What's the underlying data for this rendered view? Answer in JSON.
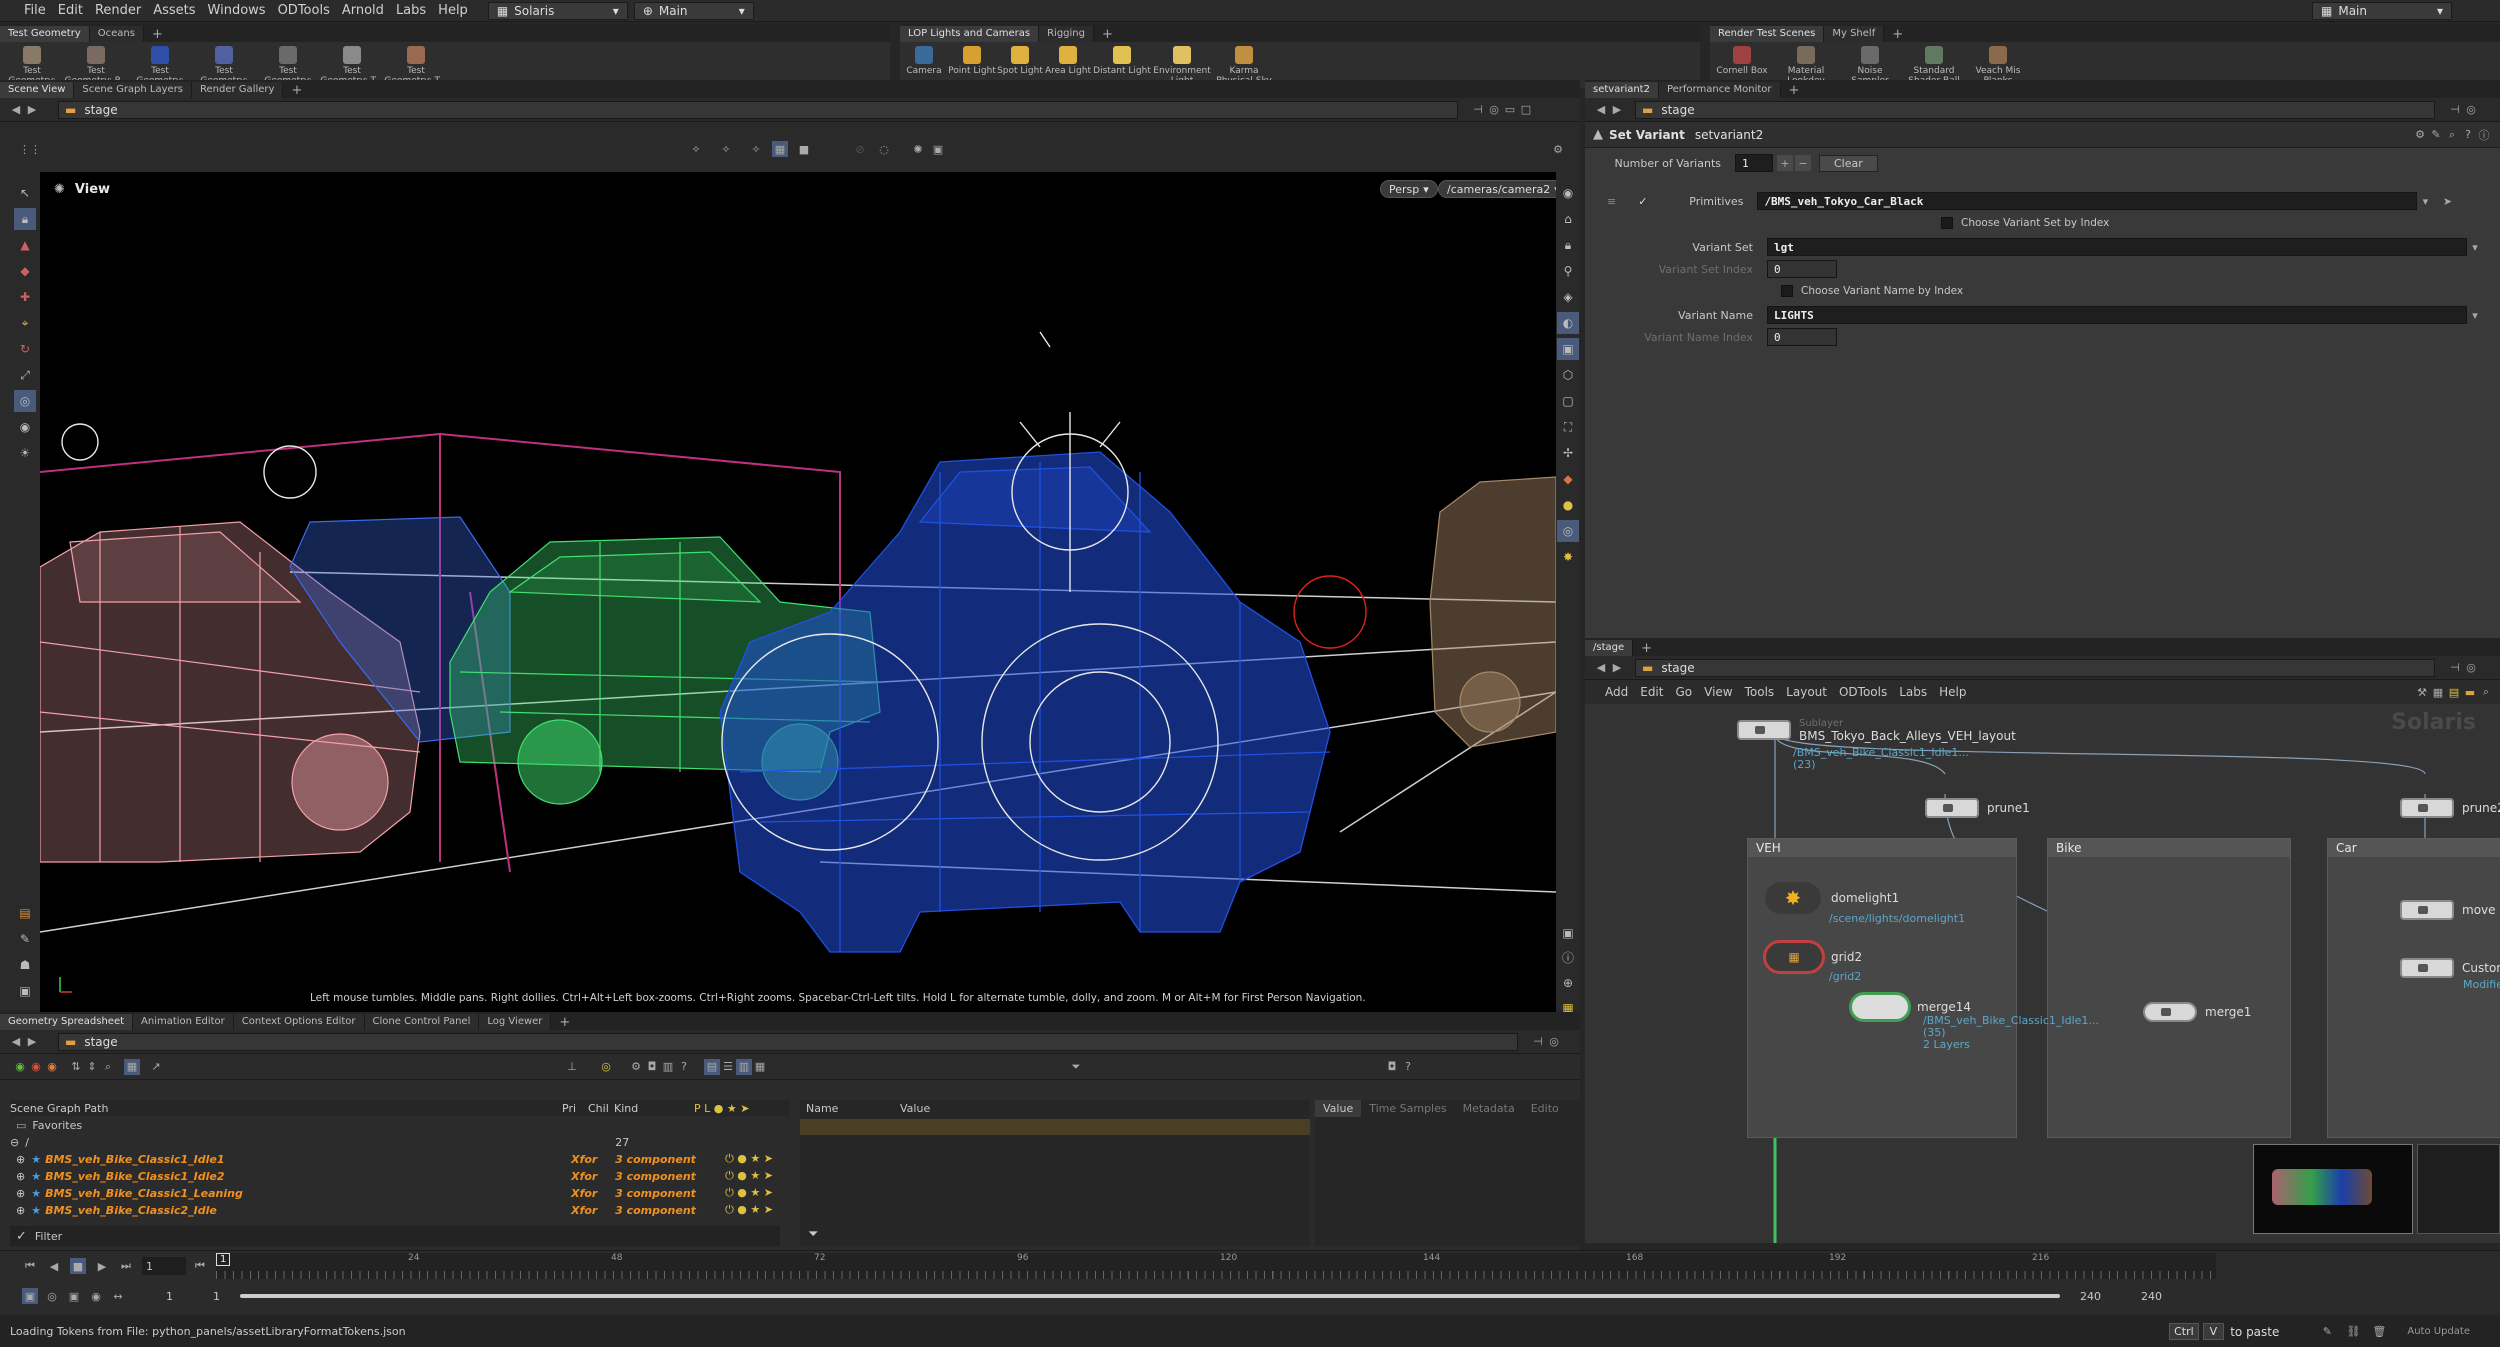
{
  "menubar": {
    "items": [
      "File",
      "Edit",
      "Render",
      "Assets",
      "Windows",
      "ODTools",
      "Arnold",
      "Labs",
      "Help"
    ],
    "desktop": "Solaris",
    "context": "Main",
    "right_desktop": "Main"
  },
  "shelf_left": {
    "tabs": [
      "Test Geometry",
      "Oceans"
    ],
    "tools": [
      "Test Geometry: C...",
      "Test Geometry: P...",
      "Test Geometry: R...",
      "Test Geometry: S...",
      "Test Geometry: S...",
      "Test Geometry: T...",
      "Test Geometry: T..."
    ]
  },
  "shelf_mid": {
    "tabs": [
      "LOP Lights and Cameras",
      "Rigging"
    ],
    "tools": [
      "Camera",
      "Point Light",
      "Spot Light",
      "Area Light",
      "Distant Light",
      "Environment Light",
      "Karma Physical Sky"
    ]
  },
  "shelf_right": {
    "tabs": [
      "Render Test Scenes",
      "My Shelf"
    ],
    "tools": [
      "Cornell Box",
      "Material Lookdev",
      "Noise Sampler",
      "Standard Shader Ball",
      "Veach Mis Planks"
    ]
  },
  "viewer": {
    "tabs": [
      "Scene View",
      "Scene Graph Layers",
      "Render Gallery"
    ],
    "path": "stage",
    "title": "View",
    "persp": "Persp",
    "camera": "/cameras/camera2",
    "hint": "Left mouse tumbles. Middle pans. Right dollies. Ctrl+Alt+Left box-zooms. Ctrl+Right zooms. Spacebar-Ctrl-Left tilts. Hold L for alternate tumble, dolly, and zoom. M or Alt+M for First Person Navigation."
  },
  "params": {
    "tabs": [
      "setvariant2",
      "Performance Monitor"
    ],
    "path": "stage",
    "node_type": "Set Variant",
    "node_name": "setvariant2",
    "num_variants_label": "Number of Variants",
    "num_variants": "1",
    "clear_label": "Clear",
    "primitives_label": "Primitives",
    "primitives": "/BMS_veh_Tokyo_Car_Black",
    "choose_set_index": "Choose Variant Set by Index",
    "variant_set_label": "Variant Set",
    "variant_set": "lgt",
    "variant_set_index_label": "Variant Set Index",
    "variant_set_index": "0",
    "choose_name_index": "Choose Variant Name by Index",
    "variant_name_label": "Variant Name",
    "variant_name": "LIGHTS",
    "variant_name_index_label": "Variant Name Index",
    "variant_name_index": "0"
  },
  "network": {
    "tab": "/stage",
    "path": "stage",
    "menu": [
      "Add",
      "Edit",
      "Go",
      "View",
      "Tools",
      "Layout",
      "ODTools",
      "Labs",
      "Help"
    ],
    "watermark": "Solaris",
    "sublayer_type": "Sublayer",
    "sublayer_name": "BMS_Tokyo_Back_Alleys_VEH_layout",
    "sublayer_path": "/BMS_veh_Bike_Classic1_Idle1...",
    "sublayer_count": "(23)",
    "prune1": "prune1",
    "prune2": "prune2",
    "boxes": [
      "VEH",
      "Bike",
      "Car"
    ],
    "domelight": "domelight1",
    "domelight_path": "/scene/lights/domelight1",
    "grid": "grid2",
    "grid_path": "/grid2",
    "merge14": "merge14",
    "merge14_path": "/BMS_veh_Bike_Classic1_Idle1...",
    "merge14_count": "(35)",
    "merge14_layers": "2 Layers",
    "merge_other": "merge1",
    "move": "move",
    "custom": "Custom_",
    "custom_sub": "Modified:"
  },
  "scene_graph": {
    "tabs": [
      "Geometry Spreadsheet",
      "Animation Editor",
      "Context Options Editor",
      "Clone Control Panel",
      "Log Viewer"
    ],
    "path": "stage",
    "columns": [
      "Scene Graph Path",
      "Pri",
      "Chil",
      "Kind"
    ],
    "favorites": "Favorites",
    "root": "/",
    "root_count": "27",
    "rows": [
      {
        "name": "BMS_veh_Bike_Classic1_Idle1",
        "type": "Xfor",
        "kind": "3 component"
      },
      {
        "name": "BMS_veh_Bike_Classic1_Idle2",
        "type": "Xfor",
        "kind": "3 component"
      },
      {
        "name": "BMS_veh_Bike_Classic1_Leaning",
        "type": "Xfor",
        "kind": "3 component"
      },
      {
        "name": "BMS_veh_Bike_Classic2_Idle",
        "type": "Xfor",
        "kind": "3 component"
      }
    ],
    "filter": "Filter",
    "attr_cols": [
      "Name",
      "Value"
    ],
    "value_tabs": [
      "Value",
      "Time Samples",
      "Metadata",
      "Edito"
    ]
  },
  "timeline": {
    "frame": "1",
    "start": "1",
    "start2": "1",
    "end": "240",
    "end2": "240",
    "ticks": [
      "24",
      "48",
      "72",
      "96",
      "120",
      "144",
      "168",
      "192",
      "216"
    ]
  },
  "status": {
    "message": "Loading Tokens from File: python_panels/assetLibraryFormatTokens.json",
    "key1": "Ctrl",
    "key2": "V",
    "paste": "to paste",
    "auto_update": "Auto Update"
  },
  "colors": {
    "accent": "#f09020",
    "link": "#5aa8c8",
    "car_pink": "#f2a0a8",
    "car_green": "#40e070",
    "car_blue": "#2050e0",
    "car_tan": "#a88868",
    "box_magenta": "#c03080"
  }
}
